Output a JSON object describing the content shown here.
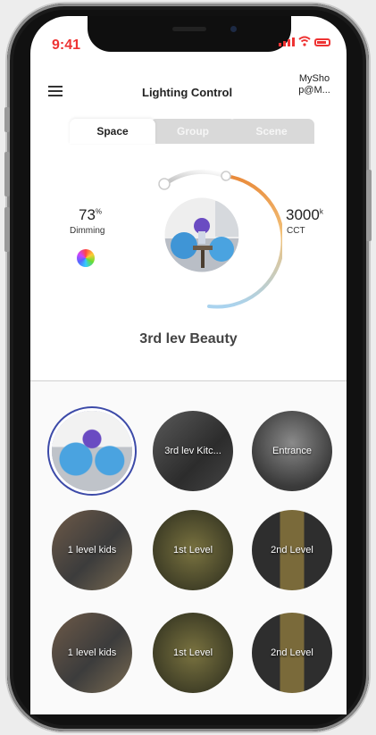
{
  "status_bar": {
    "time": "9:41"
  },
  "header": {
    "title": "Lighting Control",
    "account": "MySho p@M..."
  },
  "tabs": [
    {
      "label": "Space",
      "active": true
    },
    {
      "label": "Group",
      "active": false
    },
    {
      "label": "Scene",
      "active": false
    }
  ],
  "control": {
    "dimming_value": "73",
    "dimming_unit": "%",
    "dimming_label": "Dimming",
    "cct_value": "3000",
    "cct_unit": "k",
    "cct_label": "CCT",
    "space_name": "3rd lev Beauty"
  },
  "spaces": [
    {
      "label": "",
      "selected": true
    },
    {
      "label": "3rd lev Kitc...",
      "selected": false
    },
    {
      "label": "Entrance",
      "selected": false
    },
    {
      "label": "1 level kids",
      "selected": false
    },
    {
      "label": "1st Level",
      "selected": false
    },
    {
      "label": "2nd Level",
      "selected": false
    },
    {
      "label": "1 level kids",
      "selected": false
    },
    {
      "label": "1st Level",
      "selected": false
    },
    {
      "label": "2nd Level",
      "selected": false
    }
  ],
  "colors": {
    "accent_red": "#ee3333",
    "selected_ring": "#3c4aa8",
    "cct_warm": "#e98a3a",
    "cct_cool": "#a9d3ef"
  },
  "icons": [
    "menu-icon",
    "signal-icon",
    "wifi-icon",
    "battery-icon",
    "color-wheel-icon"
  ]
}
